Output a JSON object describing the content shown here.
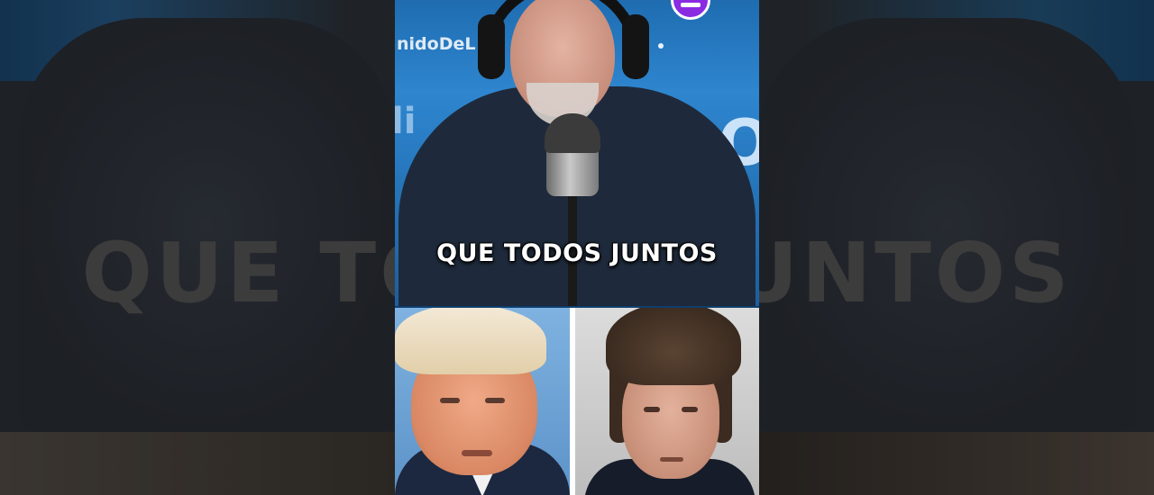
{
  "video": {
    "caption": "QUE TODOS JUNTOS",
    "background_caption": "QUE TODOS JUNTOS",
    "studio_wall_text": "nidoDeL",
    "studio_wall_large_text": "O",
    "studio_wall_left_text": "li"
  },
  "colors": {
    "studio_blue": "#2e86cf",
    "caption_text": "#ffffff",
    "logo_badge": "#8a2be2"
  },
  "icons": {
    "channel_logo": "channel-logo-icon"
  }
}
